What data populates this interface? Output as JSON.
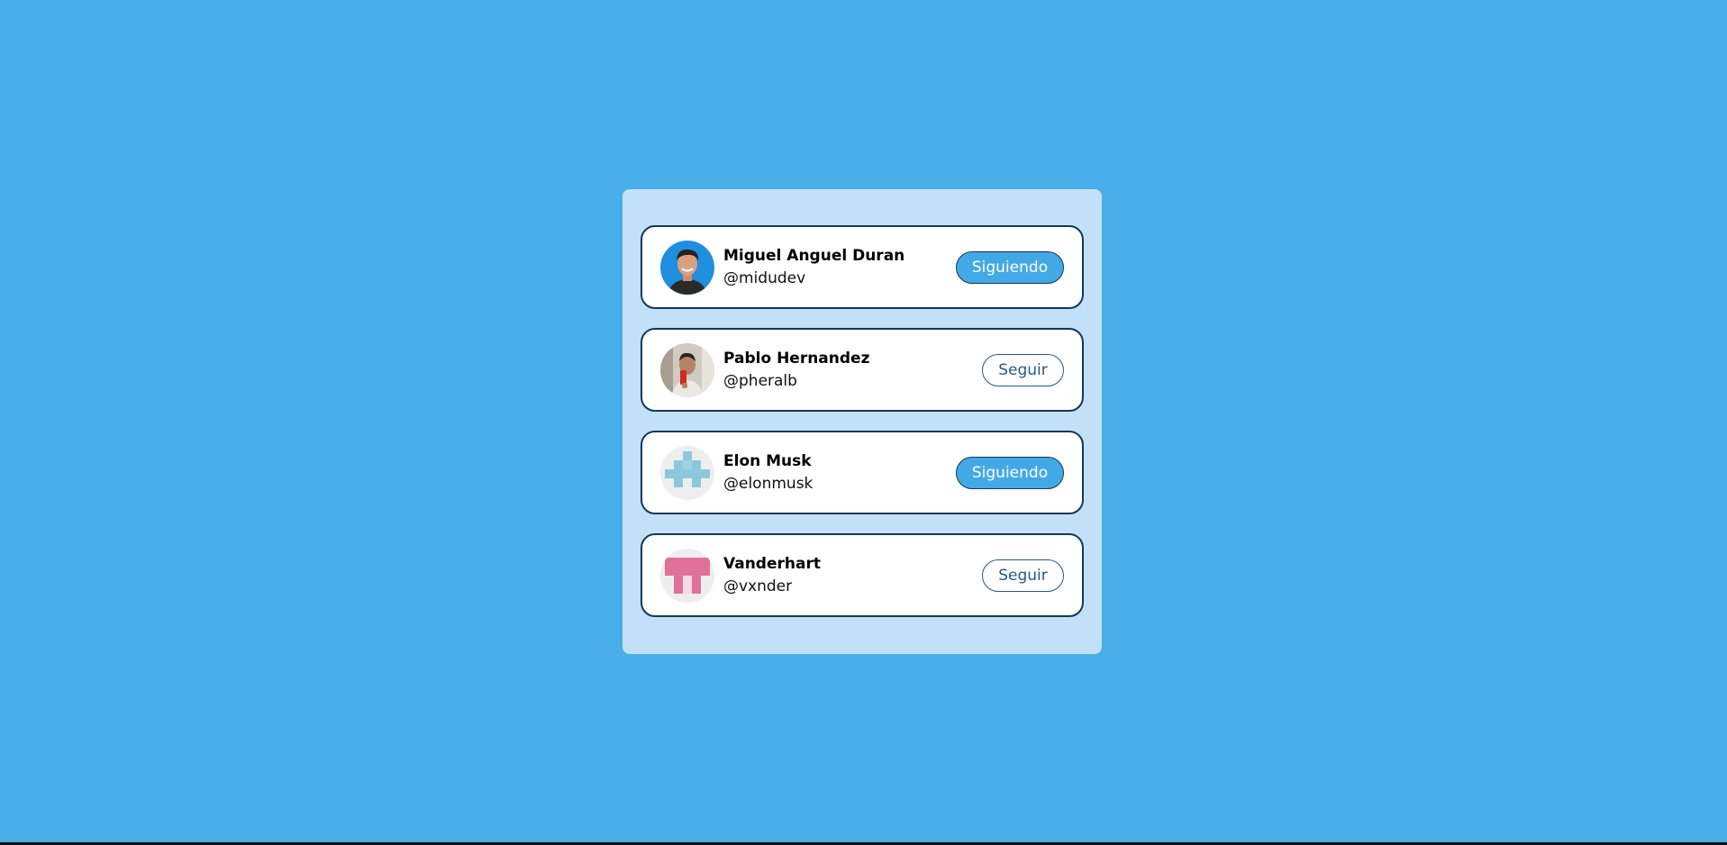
{
  "colors": {
    "background": "#47aeea",
    "panel": "#c2e1f8",
    "card_border": "#12385a",
    "following_button": "#43a9e6",
    "follow_button_text": "#1e5a8a"
  },
  "users": [
    {
      "name": "Miguel Anguel Duran",
      "handle": "@midudev",
      "button_label": "Siguiendo",
      "following": true,
      "avatar_icon": "photo-avatar"
    },
    {
      "name": "Pablo Hernandez",
      "handle": "@pheralb",
      "button_label": "Seguir",
      "following": false,
      "avatar_icon": "photo-avatar"
    },
    {
      "name": "Elon Musk",
      "handle": "@elonmusk",
      "button_label": "Siguiendo",
      "following": true,
      "avatar_icon": "pixel-identicon-blue"
    },
    {
      "name": "Vanderhart",
      "handle": "@vxnder",
      "button_label": "Seguir",
      "following": false,
      "avatar_icon": "pixel-identicon-pink"
    }
  ]
}
